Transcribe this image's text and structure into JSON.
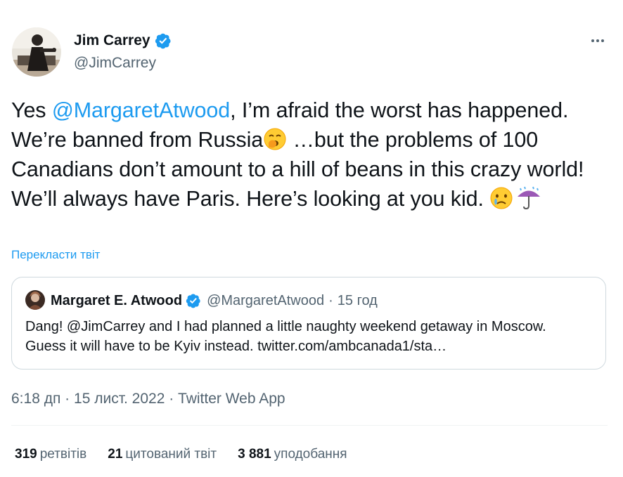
{
  "author": {
    "name": "Jim Carrey",
    "handle": "@JimCarrey"
  },
  "tweet": {
    "text_part1": "Yes ",
    "mention": "@MargaretAtwood",
    "text_part2": ", I’m afraid the worst has happened. We’re banned from Russia",
    "text_part3": " …but the problems of 100 Canadians don’t amount to a hill of beans in this crazy world! We’ll always have Paris. Here’s looking at you kid. ",
    "emoji_1": "yawning-face-icon",
    "emoji_2": "crying-face-icon",
    "emoji_3": "umbrella-with-rain-icon"
  },
  "translate_label": "Перекласти твіт",
  "quote": {
    "name": "Margaret E. Atwood",
    "handle": "@MargaretAtwood",
    "separator": "·",
    "time": "15 год",
    "text": "Dang! @JimCarrey and I had planned a little naughty weekend getaway in Moscow. Guess it will have to be Kyiv instead. twitter.com/ambcanada1/sta…"
  },
  "meta": {
    "time": "6:18 дп",
    "separator": " · ",
    "date": "15 лист. 2022",
    "source": "Twitter Web App"
  },
  "stats": [
    {
      "count": "319",
      "label": "ретвітів"
    },
    {
      "count": "21",
      "label": "цитований твіт"
    },
    {
      "count": "3 881",
      "label": "уподобання"
    }
  ],
  "colors": {
    "accent": "#1d9bf0",
    "text_primary": "#0f1419",
    "text_secondary": "#536471",
    "border": "#cfd9de"
  }
}
